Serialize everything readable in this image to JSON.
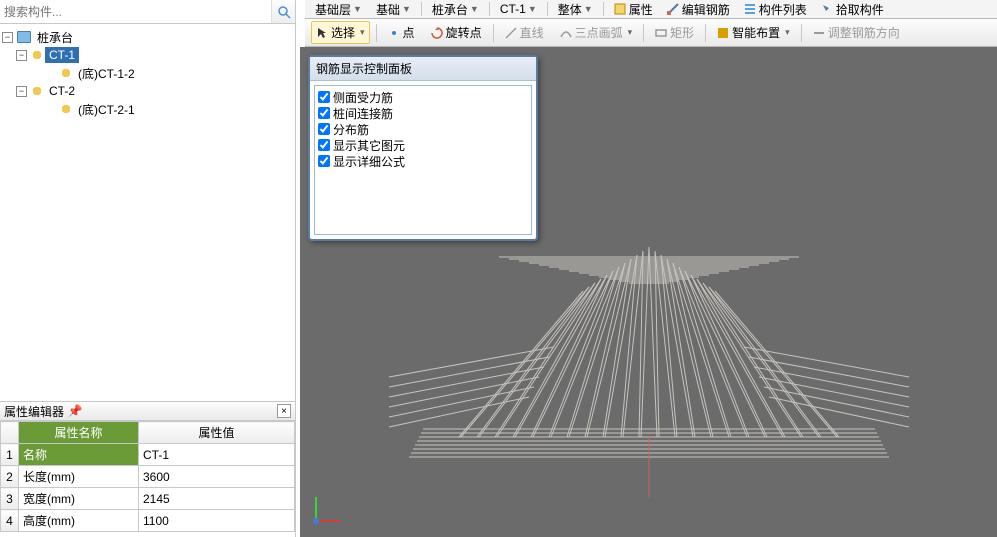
{
  "search": {
    "placeholder": "搜索构件..."
  },
  "topbar": {
    "combo1": "基础层",
    "combo2": "基础",
    "combo3": "桩承台",
    "combo4": "CT-1",
    "combo5": "整体",
    "b_prop": "属性",
    "b_edit": "编辑钢筋",
    "b_list": "构件列表",
    "b_pick": "拾取构件"
  },
  "toolbar2": {
    "select": "选择",
    "point": "点",
    "rotpoint": "旋转点",
    "line": "直线",
    "arc3": "三点画弧",
    "rect": "矩形",
    "smart": "智能布置",
    "adjust": "调整钢筋方向"
  },
  "tree": {
    "root": "桩承台",
    "n1": "CT-1",
    "n1a": "(底)CT-1-2",
    "n2": "CT-2",
    "n2a": "(底)CT-2-1"
  },
  "prop": {
    "header": "属性编辑器",
    "col1": "属性名称",
    "col2": "属性值",
    "rows": [
      {
        "n": "1",
        "k": "名称",
        "v": "CT-1"
      },
      {
        "n": "2",
        "k": "长度(mm)",
        "v": "3600"
      },
      {
        "n": "3",
        "k": "宽度(mm)",
        "v": "2145"
      },
      {
        "n": "4",
        "k": "高度(mm)",
        "v": "1100"
      }
    ]
  },
  "panel": {
    "title": "钢筋显示控制面板",
    "items": [
      "侧面受力筋",
      "桩间连接筋",
      "分布筋",
      "显示其它图元",
      "显示详细公式"
    ]
  }
}
